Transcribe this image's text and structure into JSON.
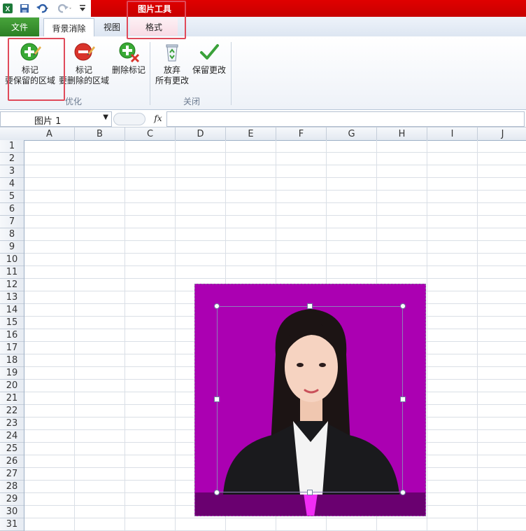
{
  "titlebar": {
    "contextual_group": "图片工具"
  },
  "tabs": {
    "file": "文件",
    "background_removal": "背景消除",
    "view": "视图",
    "format": "格式"
  },
  "ribbon": {
    "mark_keep": {
      "line1": "标记",
      "line2": "要保留的区域"
    },
    "mark_remove": {
      "line1": "标记",
      "line2": "要删除的区域"
    },
    "delete_mark": {
      "line1": "删除标记"
    },
    "discard": {
      "line1": "放弃",
      "line2": "所有更改"
    },
    "keep_changes": {
      "line1": "保留更改"
    },
    "group_refine": "优化",
    "group_close": "关闭"
  },
  "formula_bar": {
    "name_box": "图片 1",
    "fx": "fx",
    "value": ""
  },
  "columns": [
    "A",
    "B",
    "C",
    "D",
    "E",
    "F",
    "G",
    "H",
    "I",
    "J"
  ],
  "rows": [
    "1",
    "2",
    "3",
    "4",
    "5",
    "6",
    "7",
    "8",
    "9",
    "10",
    "11",
    "12",
    "13",
    "14",
    "15",
    "16",
    "17",
    "18",
    "19",
    "20",
    "21",
    "22",
    "23",
    "24",
    "25",
    "26",
    "27",
    "28",
    "29",
    "30",
    "31"
  ],
  "picture": {
    "background_color": "#ab00b2",
    "subject": "portrait-photo"
  },
  "colors": {
    "titlebar_red": "#e00000",
    "file_tab_green": "#2c7f24",
    "highlight": "#e04a5a"
  }
}
